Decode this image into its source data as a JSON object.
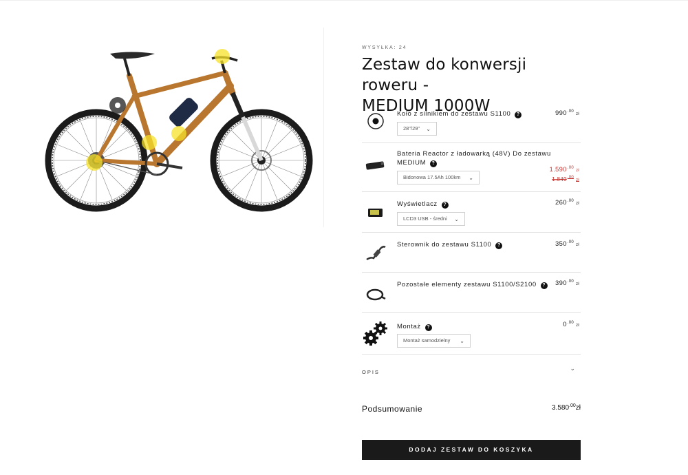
{
  "product": {
    "shipping": "WYSYŁKA: 24",
    "title_line1": "Zestaw do konwersji roweru -",
    "title_line2": "MEDIUM 1000W"
  },
  "items": [
    {
      "name": "Koło z silnikiem do zestawu S1100",
      "price": "990",
      "price_dec": ".00",
      "currency": "zł",
      "select": "28\"/29\"",
      "icon": "wheel-hub-icon"
    },
    {
      "name_line1": "Bateria Reactor z ładowarką (48V) Do zestawu",
      "name_line2": "MEDIUM",
      "price": "1.590",
      "price_dec": ".00",
      "currency": "zł",
      "old_price": "1.849",
      "old_price_dec": ".00",
      "select": "Bidonowa 17.5Ah 100km",
      "icon": "battery-icon"
    },
    {
      "name": "Wyświetlacz",
      "price": "260",
      "price_dec": ".00",
      "currency": "zł",
      "select": "LCD3 USB - średni",
      "icon": "display-icon"
    },
    {
      "name": "Sterownik do zestawu S1100",
      "price": "350",
      "price_dec": ".00",
      "currency": "zł",
      "icon": "controller-icon"
    },
    {
      "name": "Pozostałe elementy zestawu S1100/S2100",
      "price": "390",
      "price_dec": ".00",
      "currency": "zł",
      "icon": "cable-icon"
    },
    {
      "name": "Montaż",
      "price": "0",
      "price_dec": ".00",
      "currency": "zł",
      "select": "Montaż samodzielny",
      "icon": "gears-icon"
    }
  ],
  "help_glyph": "?",
  "chevron_glyph": "⌄",
  "description": {
    "label": "OPIS"
  },
  "summary": {
    "label": "Podsumowanie",
    "total": "3.580",
    "total_dec": ".00",
    "currency": "zł"
  },
  "cta": {
    "label": "DODAJ ZESTAW DO KOSZYKA"
  },
  "colors": {
    "frame": "#b8762e",
    "button": "#1a1a1a",
    "sale": "#c9302c",
    "hotspot": "#f5e12a"
  }
}
